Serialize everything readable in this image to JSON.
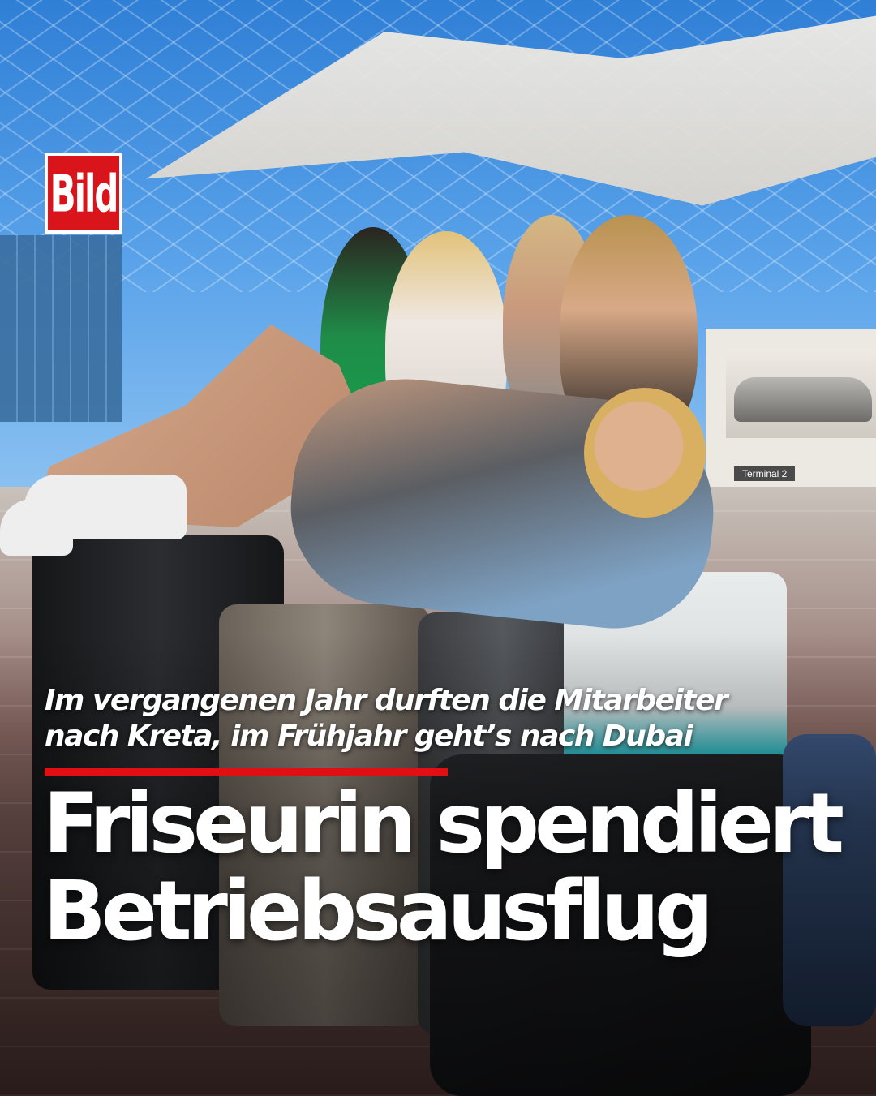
{
  "brand": {
    "logo_text": "Bild",
    "logo_color": "#d9141b"
  },
  "photo": {
    "sign_text": "Terminal 2"
  },
  "article": {
    "subline": [
      "Im vergangenen Jahr durften die Mitarbeiter",
      "nach Kreta, im Frühjahr geht’s nach Dubai"
    ],
    "headline": [
      "Friseurin spendiert",
      "Betriebsausflug"
    ],
    "accent_color": "#e10f14"
  }
}
